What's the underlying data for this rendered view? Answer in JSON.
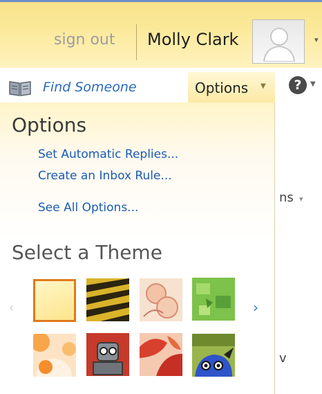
{
  "header": {
    "sign_out": "sign out",
    "user_name": "Molly Clark"
  },
  "toolbar": {
    "find_someone": "Find Someone",
    "options_tab": "Options"
  },
  "options_panel": {
    "title": "Options",
    "links": [
      "Set Automatic Replies...",
      "Create an Inbox Rule...",
      "See All Options..."
    ],
    "theme_title": "Select a Theme",
    "themes": [
      {
        "name": "pale-yellow",
        "selected": true
      },
      {
        "name": "yellow-tiger",
        "selected": false
      },
      {
        "name": "peach-sketch",
        "selected": false
      },
      {
        "name": "green-leaves",
        "selected": false
      },
      {
        "name": "orange-swirl",
        "selected": false
      },
      {
        "name": "robot",
        "selected": false
      },
      {
        "name": "red-leaves",
        "selected": false
      },
      {
        "name": "blue-creature",
        "selected": false
      }
    ]
  },
  "background": {
    "partial_menu_text": "ns",
    "partial_letter": "v"
  },
  "colors": {
    "accent_orange": "#e07a1d",
    "link_blue": "#1a5bb3",
    "header_yellow": "#fbe99a"
  }
}
